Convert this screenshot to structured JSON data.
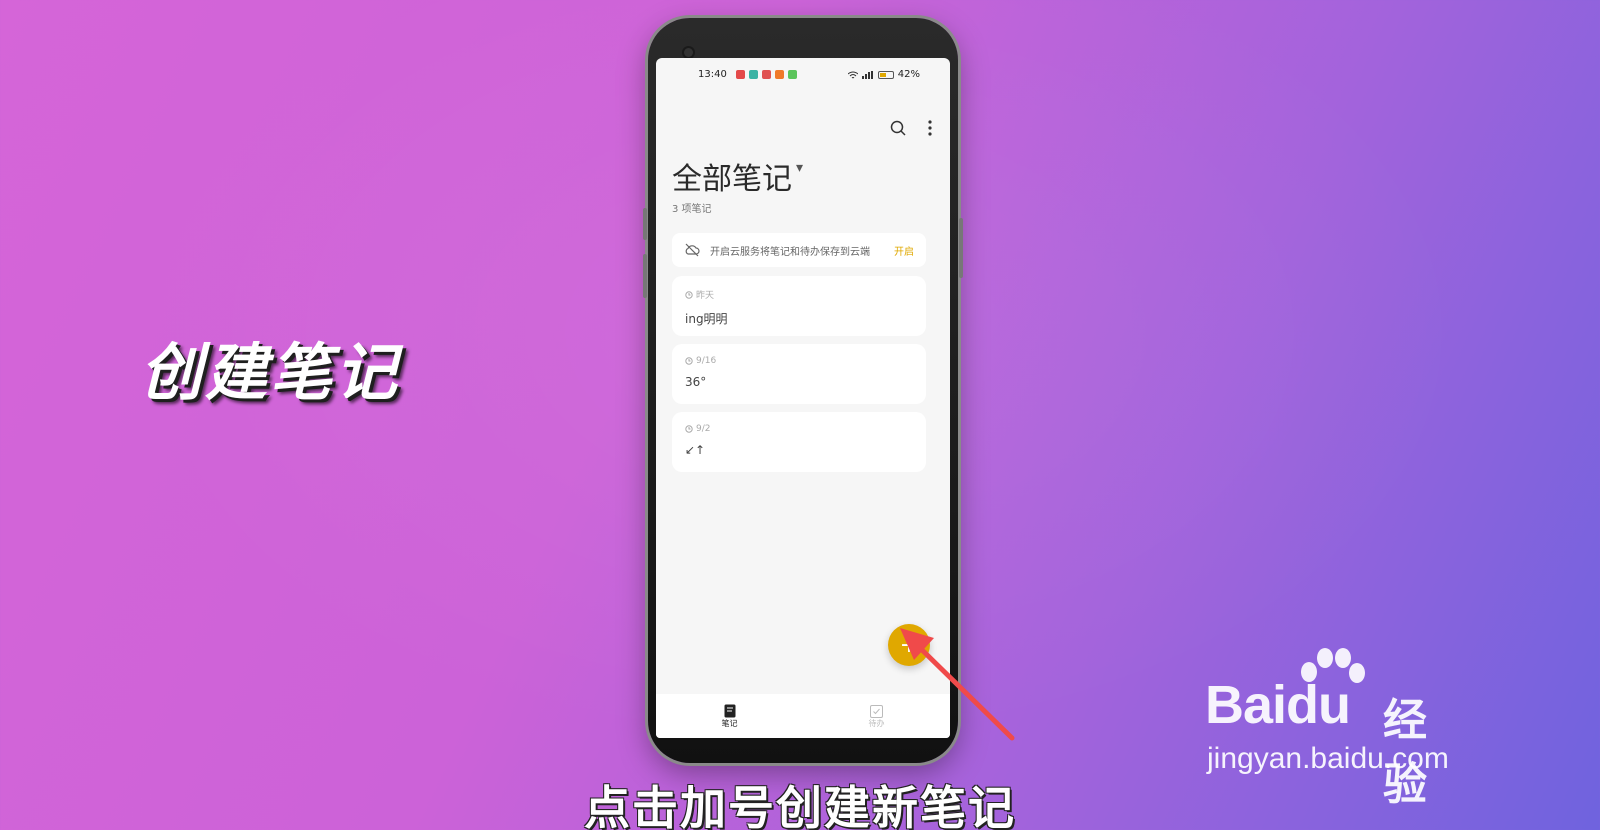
{
  "overlay": {
    "side_title": "创建笔记",
    "caption": "点击加号创建新笔记",
    "watermark_logo": "Baidu",
    "watermark_jingyan": "经验",
    "watermark_url": "jingyan.baidu.com"
  },
  "status_bar": {
    "time": "13:40",
    "battery": "42%"
  },
  "header": {
    "title": "全部笔记",
    "dropdown": "▾",
    "count": "3 项笔记"
  },
  "cloud_banner": {
    "text": "开启云服务将笔记和待办保存到云端",
    "action": "开启"
  },
  "notes": [
    {
      "date": "昨天",
      "content": "ing明明"
    },
    {
      "date": "9/16",
      "content": "36°"
    },
    {
      "date": "9/2",
      "content": "↙↑"
    }
  ],
  "fab": {
    "label": "+"
  },
  "tabs": [
    {
      "label": "笔记",
      "active": true
    },
    {
      "label": "待办",
      "active": false
    }
  ],
  "colors": {
    "accent": "#e0a800",
    "arrow": "#f04a4a"
  },
  "icons": [
    "search-icon",
    "more-vertical-icon",
    "cloud-off-icon",
    "clock-icon",
    "note-icon",
    "todo-check-icon",
    "plus-icon"
  ]
}
